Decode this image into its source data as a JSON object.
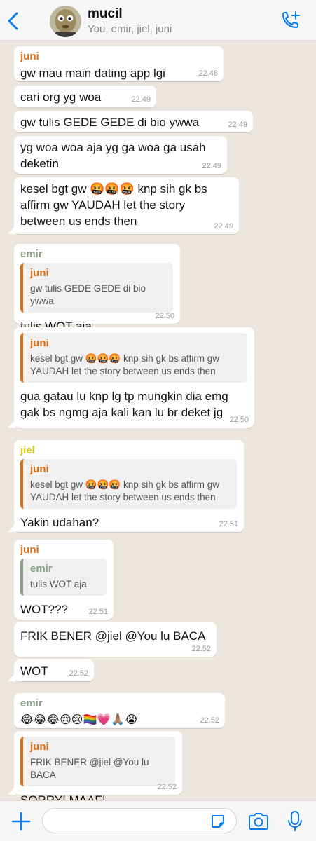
{
  "header": {
    "title": "mucil",
    "subtitle": "You, emir, jiel, juni"
  },
  "colors": {
    "juni": "#e06e13",
    "emir": "#8aa08a",
    "jiel": "#d9c31b",
    "accent": "#0a7cf5"
  },
  "messages": [
    {
      "sender": "juni",
      "text": "gw mau main dating app lgi",
      "time": "22.48"
    },
    {
      "text": "cari org yg woa",
      "time": "22.49"
    },
    {
      "text": "gw tulis GEDE GEDE di bio ywwa",
      "time": "22.49"
    },
    {
      "text": "yg woa woa aja yg ga woa ga usah\ndeketin",
      "time": "22.49"
    },
    {
      "text": "kesel bgt gw 🤬🤬🤬 knp sih gk bs\naffirm gw YAUDAH let the story\nbetween us ends then",
      "time": "22.49"
    },
    {
      "sender": "emir",
      "quote_name": "juni",
      "quote_text": "gw tulis GEDE GEDE di bio ywwa",
      "text": "tulis WOT aja",
      "time": "22.50"
    },
    {
      "quote_name": "juni",
      "quote_text": "kesel bgt gw 🤬🤬🤬 knp sih gk bs affirm gw\nYAUDAH let the story between us ends then",
      "text": "gua gatau lu knp lg tp mungkin dia emg\ngak bs ngmg aja kali kan lu br deket jg",
      "time": "22.50"
    },
    {
      "sender": "jiel",
      "quote_name": "juni",
      "quote_text": "kesel bgt gw 🤬🤬🤬 knp sih gk bs affirm gw\nYAUDAH let the story between us ends then",
      "text": "Yakin udahan?",
      "time": "22.51"
    },
    {
      "sender": "juni",
      "quote_name": "emir",
      "quote_text": "tulis WOT aja",
      "text": "WOT???",
      "time": "22.51"
    },
    {
      "text": "FRIK BENER @jiel @You lu BACA",
      "time": "22.52"
    },
    {
      "text": "WOT",
      "time": "22.52"
    },
    {
      "sender": "emir",
      "text": "😂😂😂😢😢🏳️‍🌈💗🙏🏽😭",
      "time": "22.52"
    },
    {
      "quote_name": "juni",
      "quote_text": "FRIK BENER @jiel @You lu BACA",
      "text": "SORRY! MAAF!",
      "time": "22.52"
    }
  ],
  "composer": {
    "value": "",
    "placeholder": ""
  },
  "icons": {
    "back": "chevron-left-icon",
    "call": "add-call-icon",
    "plus": "plus-icon",
    "sticker": "sticker-icon",
    "camera": "camera-icon",
    "mic": "microphone-icon"
  }
}
